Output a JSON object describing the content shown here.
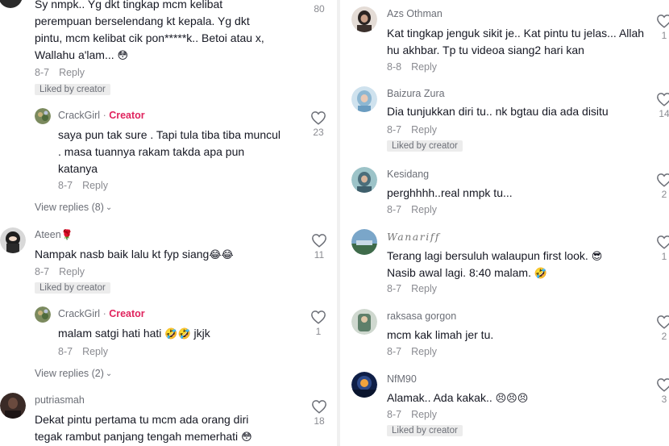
{
  "left": {
    "c1": {
      "text": "Sy nmpk.. Yg dkt tingkap mcm kelibat perempuan berselendang kt kepala. Yg dkt pintu, mcm kelibat cik pon*****k.. Betoi atau x, Wallahu a'lam...",
      "emojis": "😳",
      "date": "8-7",
      "reply": "Reply",
      "liked": "Liked by creator",
      "likes": "80"
    },
    "c2": {
      "user": "CrackGirl",
      "sep": " · ",
      "creator": "Creator",
      "text": "saya pun tak sure . Tapi tula tiba tiba muncul . masa tuannya rakam takda apa pun katanya",
      "date": "8-7",
      "reply": "Reply",
      "likes": "23"
    },
    "view1": "View replies (8)",
    "c3": {
      "user": "Ateen",
      "flower": "🌹",
      "text": "Nampak nasb baik lalu kt fyp siang",
      "emojis": "😂😂",
      "date": "8-7",
      "reply": "Reply",
      "liked": "Liked by creator",
      "likes": "11"
    },
    "c4": {
      "user": "CrackGirl",
      "sep": " · ",
      "creator": "Creator",
      "text": "malam satgi hati hati",
      "emojis": "🤣🤣",
      "text2": " jkjk",
      "date": "8-7",
      "reply": "Reply",
      "likes": "1"
    },
    "view2": "View replies (2)",
    "c5": {
      "user": "putriasmah",
      "text": "Dekat pintu pertama tu mcm ada orang diri tegak rambut panjang tengah memerhati",
      "emojis": "😳",
      "likes": "18"
    }
  },
  "right": {
    "c1": {
      "user": "Azs Othman",
      "text": "Kat tingkap jenguk sikit je.. Kat pintu tu jelas... Allah hu akhbar. Tp tu videoa siang2 hari kan",
      "date": "8-8",
      "reply": "Reply",
      "likes": "1"
    },
    "c2": {
      "user": "Baizura Zura",
      "text": "Dia tunjukkan diri tu.. nk bgtau dia ada disitu",
      "date": "8-7",
      "reply": "Reply",
      "liked": "Liked by creator",
      "likes": "14"
    },
    "c3": {
      "user": "Kesidang",
      "text": "perghhhh..real nmpk tu...",
      "date": "8-7",
      "reply": "Reply",
      "likes": "2"
    },
    "c4": {
      "user": "Wanariff",
      "text1": "Terang lagi bersuluh walaupun first look.",
      "emojis1": "😎",
      "text2": "Nasib awal lagi. 8:40 malam.",
      "emojis2": "🤣",
      "date": "8-7",
      "reply": "Reply",
      "likes": "1"
    },
    "c5": {
      "user": "raksasa gorgon",
      "text": "mcm kak limah jer tu.",
      "date": "8-7",
      "reply": "Reply",
      "likes": "2"
    },
    "c6": {
      "user": "NfM90",
      "text": "Alamak.. Ada kakak..",
      "emojis": "😣😣😣",
      "date": "8-7",
      "reply": "Reply",
      "liked": "Liked by creator",
      "likes": "3"
    }
  },
  "icons": {
    "like": "heart-outline-icon",
    "chevron": "chevron-down-icon"
  }
}
